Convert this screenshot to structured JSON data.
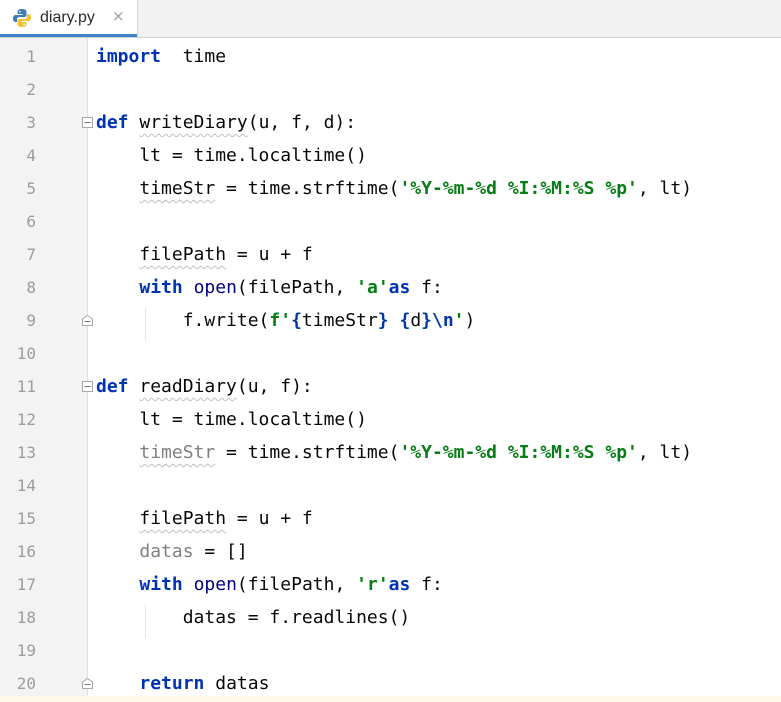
{
  "tab": {
    "title": "diary.py",
    "close": "×"
  },
  "lines": [
    {
      "n": "1",
      "tokens": [
        [
          "kw",
          "import"
        ],
        [
          "",
          "  time"
        ]
      ]
    },
    {
      "n": "2",
      "tokens": []
    },
    {
      "n": "3",
      "tokens": [
        [
          "kw",
          "def"
        ],
        [
          "",
          " "
        ],
        [
          "squig",
          "writeDiary"
        ],
        [
          "",
          "(u, f, d):"
        ]
      ]
    },
    {
      "n": "4",
      "tokens": [
        [
          "",
          "    lt = time.localtime()"
        ]
      ]
    },
    {
      "n": "5",
      "tokens": [
        [
          "",
          "    "
        ],
        [
          "squig",
          "timeStr"
        ],
        [
          "",
          " = time.strftime("
        ],
        [
          "str",
          "'%Y-%m-%d %I:%M:%S %p'"
        ],
        [
          "",
          ", lt)"
        ]
      ]
    },
    {
      "n": "6",
      "tokens": []
    },
    {
      "n": "7",
      "tokens": [
        [
          "",
          "    "
        ],
        [
          "squig",
          "filePath"
        ],
        [
          "",
          " = u + f"
        ]
      ]
    },
    {
      "n": "8",
      "tokens": [
        [
          "",
          "    "
        ],
        [
          "kw",
          "with"
        ],
        [
          "",
          " "
        ],
        [
          "bi",
          "open"
        ],
        [
          "",
          "(filePath, "
        ],
        [
          "str",
          "'a'"
        ],
        [
          ") "
        ],
        [
          "kw",
          "as"
        ],
        [
          "",
          " f:"
        ]
      ]
    },
    {
      "n": "9",
      "tokens": [
        [
          "",
          "        f.write("
        ],
        [
          "str",
          "f'"
        ],
        [
          "esc",
          "{"
        ],
        [
          "",
          "timeStr"
        ],
        [
          "esc",
          "}"
        ],
        [
          "str",
          " "
        ],
        [
          "esc",
          "{"
        ],
        [
          "",
          "d"
        ],
        [
          "esc",
          "}\\n"
        ],
        [
          "str",
          "'"
        ],
        [
          "",
          ")"
        ]
      ]
    },
    {
      "n": "10",
      "tokens": []
    },
    {
      "n": "11",
      "tokens": [
        [
          "kw",
          "def"
        ],
        [
          "",
          " "
        ],
        [
          "squig",
          "readDiary"
        ],
        [
          "",
          "(u, f):"
        ]
      ]
    },
    {
      "n": "12",
      "tokens": [
        [
          "",
          "    lt = time.localtime()"
        ]
      ]
    },
    {
      "n": "13",
      "tokens": [
        [
          "",
          "    "
        ],
        [
          "unused squig",
          "timeStr"
        ],
        [
          "",
          " = time.strftime("
        ],
        [
          "str",
          "'%Y-%m-%d %I:%M:%S %p'"
        ],
        [
          "",
          ", lt)"
        ]
      ]
    },
    {
      "n": "14",
      "tokens": []
    },
    {
      "n": "15",
      "tokens": [
        [
          "",
          "    "
        ],
        [
          "squig",
          "filePath"
        ],
        [
          "",
          " = u + f"
        ]
      ]
    },
    {
      "n": "16",
      "tokens": [
        [
          "",
          "    "
        ],
        [
          "unused",
          "datas"
        ],
        [
          "",
          " = []"
        ]
      ]
    },
    {
      "n": "17",
      "tokens": [
        [
          "",
          "    "
        ],
        [
          "kw",
          "with"
        ],
        [
          "",
          " "
        ],
        [
          "bi",
          "open"
        ],
        [
          "",
          "(filePath, "
        ],
        [
          "str",
          "'r'"
        ],
        [
          ") "
        ],
        [
          "kw",
          "as"
        ],
        [
          "",
          " f:"
        ]
      ]
    },
    {
      "n": "18",
      "tokens": [
        [
          "",
          "        datas = f.readlines()"
        ]
      ]
    },
    {
      "n": "19",
      "tokens": []
    },
    {
      "n": "20",
      "tokens": [
        [
          "",
          "    "
        ],
        [
          "kw",
          "return"
        ],
        [
          "",
          " datas"
        ]
      ]
    }
  ],
  "colors": {
    "keyword": "#0033b3",
    "string": "#067d17",
    "builtin": "#000080",
    "unused": "#808080",
    "tab_accent": "#4083c9"
  }
}
